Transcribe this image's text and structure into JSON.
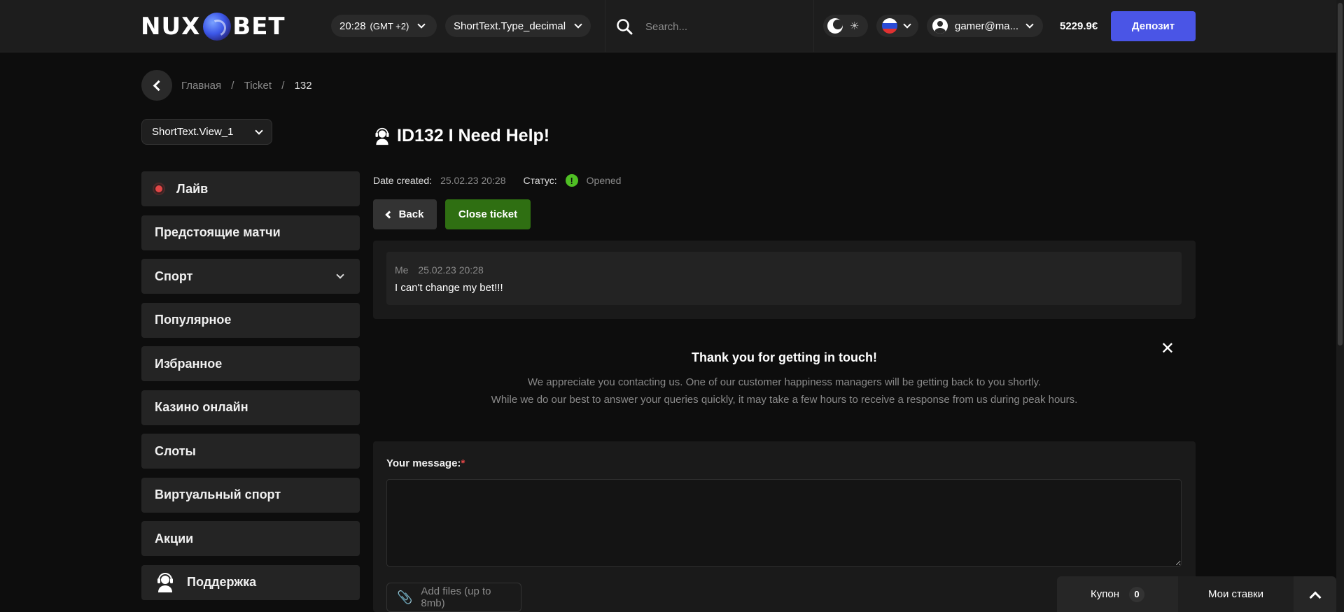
{
  "header": {
    "logo_left": "NUX",
    "logo_right": "BET",
    "time": "20:28",
    "timezone": "(GMT +2)",
    "odds_format": "ShortText.Type_decimal",
    "search_placeholder": "Search...",
    "theme_icon": "moon-icon",
    "language_flag": "flag-ru-icon",
    "user": "gamer@ma...",
    "balance": "5229.9€",
    "deposit_label": "Депозит"
  },
  "breadcrumb": [
    "Главная",
    "Ticket",
    "132"
  ],
  "sidebar": {
    "view_select": "ShortText.View_1",
    "items": [
      {
        "label": "Лайв"
      },
      {
        "label": "Предстоящие матчи"
      },
      {
        "label": "Спорт"
      },
      {
        "label": "Популярное"
      },
      {
        "label": "Избранное"
      },
      {
        "label": "Казино онлайн"
      },
      {
        "label": "Слоты"
      },
      {
        "label": "Виртуальный спорт"
      },
      {
        "label": "Акции"
      },
      {
        "label": "Поддержка"
      }
    ]
  },
  "ticket": {
    "title": "ID132 I Need Help!",
    "date_label": "Date created:",
    "date_value": "25.02.23 20:28",
    "status_label": "Статус:",
    "status_value": "Opened",
    "status_color": "#4fbf24",
    "back_label": "Back",
    "close_label": "Close ticket"
  },
  "message": {
    "author": "Me",
    "time": "25.02.23 20:28",
    "text": "I can't change my bet!!!"
  },
  "notice": {
    "heading": "Thank you for getting in touch!",
    "line1": "We appreciate you contacting us. One of our customer happiness managers will be getting back to you shortly.",
    "line2": "While we do our best to answer your queries quickly, it may take a few hours to receive a response from us during peak hours."
  },
  "form": {
    "label": "Your message:",
    "required_mark": "*",
    "attach_label": "Add files (up to 8mb)"
  },
  "bottom_bar": {
    "coupon_label": "Купон",
    "coupon_count": "0",
    "bets_label": "Мои ставки"
  },
  "colors": {
    "accent": "#4a55e6",
    "close_btn": "#2f6f12",
    "live": "#e04646"
  }
}
